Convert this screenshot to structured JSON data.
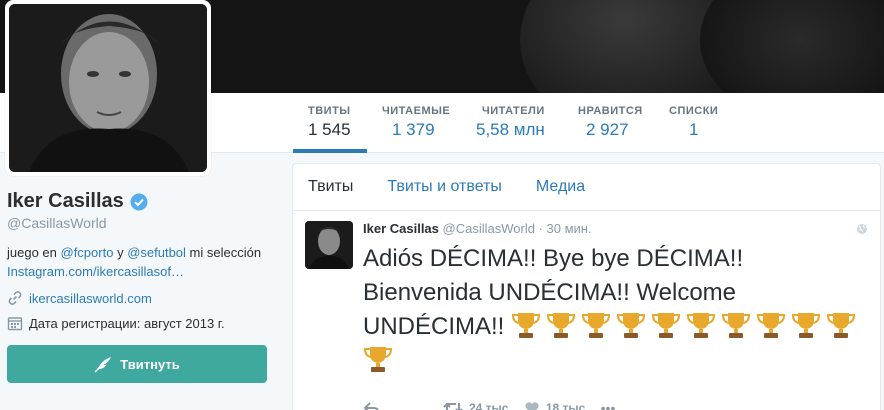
{
  "stats": [
    {
      "label": "ТВИТЫ",
      "value": "1 545",
      "active": true
    },
    {
      "label": "ЧИТАЕМЫЕ",
      "value": "1 379"
    },
    {
      "label": "ЧИТАТЕЛИ",
      "value": "5,58 млн"
    },
    {
      "label": "НРАВИТСЯ",
      "value": "2 927"
    },
    {
      "label": "СПИСКИ",
      "value": "1"
    }
  ],
  "profile": {
    "name": "Iker Casillas",
    "handle": "@CasillasWorld",
    "bio_prefix": "juego en ",
    "bio_link1": "@fcporto",
    "bio_mid": " y ",
    "bio_link2": "@sefutbol",
    "bio_suffix": " mi selección ",
    "bio_link3": "Instagram.com/ikercasillasof…",
    "website": "ikercasillasworld.com",
    "joined": "Дата регистрации: август 2013 г.",
    "verified_icon": "verified-badge-icon"
  },
  "tweet_button": {
    "label": "Твитнуть",
    "icon": "quill-icon"
  },
  "tabs": [
    {
      "label": "Твиты",
      "active": true
    },
    {
      "label": "Твиты и ответы"
    },
    {
      "label": "Медиа"
    }
  ],
  "tweet": {
    "author": "Iker Casillas",
    "handle": "@CasillasWorld",
    "time": "· 30 мин.",
    "text": "Adiós DÉCIMA!! Bye bye DÉCIMA!! Bienvenida UNDÉCIMA!! Welcome UNDÉCIMA!!",
    "trophy_count": 11,
    "retweets": "24 тыс.",
    "likes": "18 тыс.",
    "more": "•••"
  },
  "colors": {
    "accent": "#2b7bb9",
    "button": "#3fa9a0",
    "trophy": "#e8a82c"
  }
}
